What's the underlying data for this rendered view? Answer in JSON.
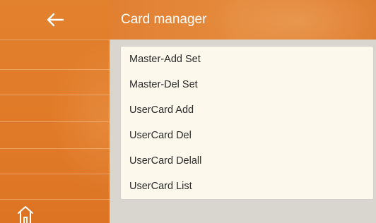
{
  "header": {
    "title": "Card manager"
  },
  "menu": {
    "items": [
      {
        "label": "Master-Add Set"
      },
      {
        "label": "Master-Del Set"
      },
      {
        "label": "UserCard Add"
      },
      {
        "label": "UserCard Del"
      },
      {
        "label": "UserCard Delall"
      },
      {
        "label": "UserCard List"
      }
    ]
  },
  "icons": {
    "back": "arrow-left-icon",
    "home": "home-icon"
  },
  "colors": {
    "accent": "#e2812e",
    "panel_bg": "#fcf9ec",
    "page_bg": "#d9d6d0",
    "title_text": "#ffffff",
    "item_text": "#2a2a2a"
  }
}
